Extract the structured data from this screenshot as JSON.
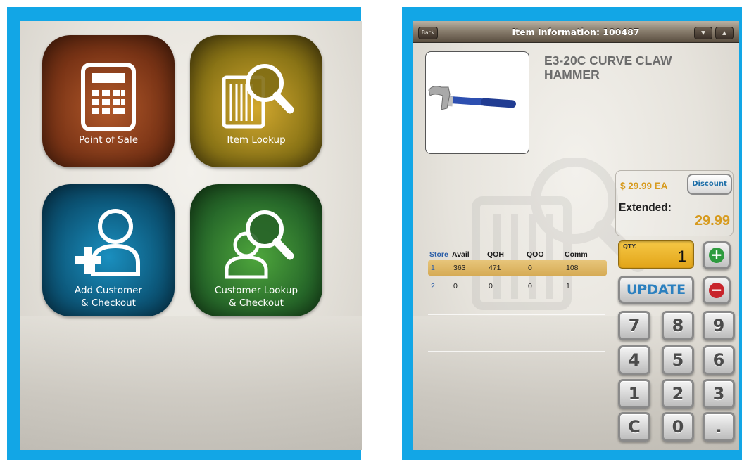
{
  "home": {
    "tiles": [
      {
        "label_lines": [
          "Point of Sale"
        ],
        "icon": "calculator-icon",
        "color": "#7a3416"
      },
      {
        "label_lines": [
          "Item Lookup"
        ],
        "icon": "barcode-magnifier-icon",
        "color": "#8a7416"
      },
      {
        "label_lines": [
          "Add Customer",
          "& Checkout"
        ],
        "icon": "add-user-icon",
        "color": "#0c5678"
      },
      {
        "label_lines": [
          "Customer Lookup",
          "& Checkout"
        ],
        "icon": "user-search-icon",
        "color": "#27692a"
      }
    ]
  },
  "item": {
    "nav": {
      "back_label": "Back",
      "title": "Item Information: 100487",
      "prev_glyph": "▼",
      "next_glyph": "▲"
    },
    "title_lines": [
      "E3-20C CURVE CLAW",
      "HAMMER"
    ],
    "price_text": "$   29.99 EA",
    "discount_label": "Discount",
    "extended_label": "Extended:",
    "extended_value": "29.99",
    "qty_label": "QTY.",
    "qty_value": "1",
    "update_label": "UPDATE",
    "plus_glyph": "+",
    "minus_glyph": "−",
    "keypad": [
      "7",
      "8",
      "9",
      "4",
      "5",
      "6",
      "1",
      "2",
      "3",
      "C",
      "0",
      "."
    ],
    "table": {
      "headers": [
        "Store",
        "Avail",
        "QOH",
        "QOO",
        "Comm"
      ],
      "rows": [
        [
          "1",
          "363",
          "471",
          "0",
          "108"
        ],
        [
          "2",
          "0",
          "0",
          "0",
          "1"
        ]
      ]
    },
    "colors": {
      "accent": "#d79b1f",
      "link": "#2c80bf",
      "frame": "#12a6e6"
    }
  }
}
